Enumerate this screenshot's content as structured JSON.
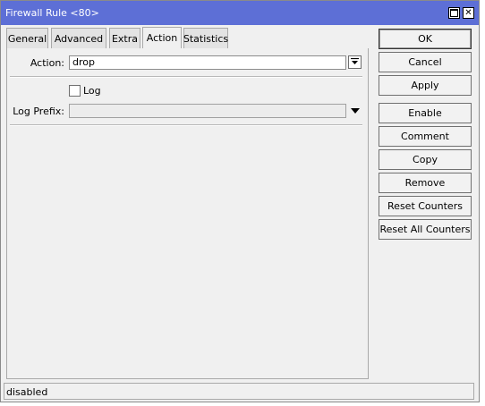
{
  "window": {
    "title": "Firewall Rule <80>"
  },
  "tabs": [
    {
      "label": "General"
    },
    {
      "label": "Advanced"
    },
    {
      "label": "Extra"
    },
    {
      "label": "Action"
    },
    {
      "label": "Statistics"
    }
  ],
  "active_tab": "Action",
  "form": {
    "action": {
      "label": "Action:",
      "value": "drop"
    },
    "log": {
      "label": "Log",
      "checked": false
    },
    "log_prefix": {
      "label": "Log Prefix:",
      "value": ""
    }
  },
  "buttons": {
    "ok": "OK",
    "cancel": "Cancel",
    "apply": "Apply",
    "enable": "Enable",
    "comment": "Comment",
    "copy": "Copy",
    "remove": "Remove",
    "reset_counters": "Reset Counters",
    "reset_all_counters": "Reset All Counters"
  },
  "status": {
    "text": "disabled"
  },
  "colors": {
    "titlebar": "#5d6fd6",
    "window_bg": "#f0f0f0"
  },
  "icons": {
    "maximize": "maximize-icon",
    "close": "close-icon",
    "dropdown": "dropdown-arrow-icon"
  }
}
